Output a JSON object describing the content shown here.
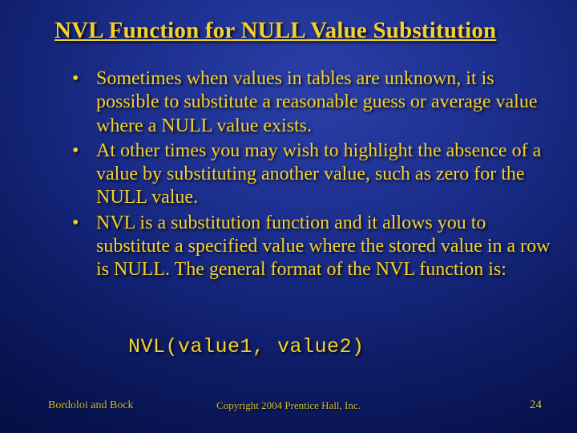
{
  "slide": {
    "title": "NVL Function for NULL Value Substitution",
    "bullets": [
      "Sometimes when values in tables are unknown, it is possible to substitute a reasonable guess or average value where a NULL value exists.",
      "At other times you may wish to highlight the absence of a value by substituting another value, such as zero for the NULL value.",
      "NVL is a substitution function and it allows you to substitute a specified value where the stored value in a row is NULL.  The general format of the NVL function is:"
    ],
    "code": "NVL(value1, value2)",
    "footer": {
      "left": "Bordoloi and Bock",
      "center": "Copyright 2004 Prentice Hall, Inc.",
      "page": "24"
    }
  }
}
